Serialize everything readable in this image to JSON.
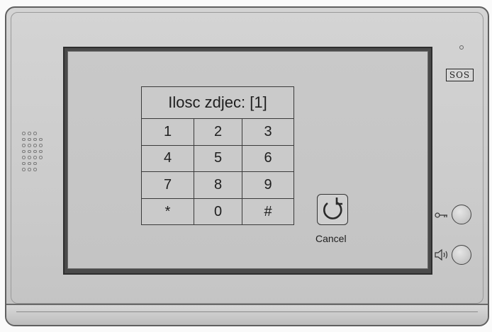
{
  "keypad": {
    "title": "Ilosc zdjec: [1]",
    "keys": [
      "1",
      "2",
      "3",
      "4",
      "5",
      "6",
      "7",
      "8",
      "9",
      "*",
      "0",
      "#"
    ]
  },
  "cancel": {
    "label": "Cancel",
    "icon": "refresh-icon"
  },
  "side_panel": {
    "sos_label": "SOS",
    "unlock_icon": "key-icon",
    "talk_icon": "speaker-icon"
  },
  "colors": {
    "body": "#cbcbcb",
    "screen": "#c6c6c6",
    "bezel": "#4a4a4a",
    "text": "#1e1e1e"
  }
}
